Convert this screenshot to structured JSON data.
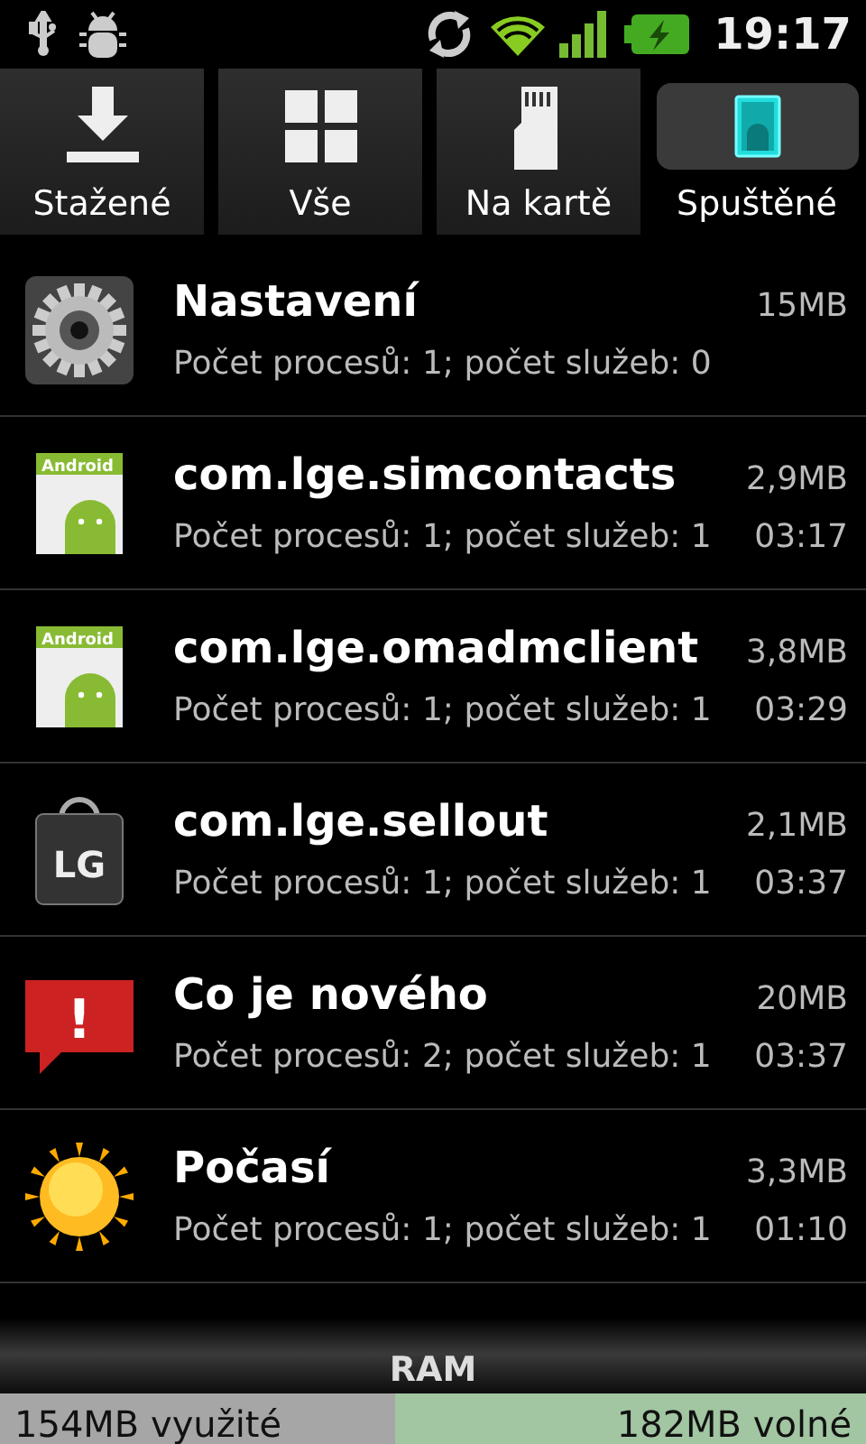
{
  "status_bar": {
    "time": "19:17"
  },
  "tabs": [
    {
      "label": "Stažené",
      "kind": "download",
      "selected": false
    },
    {
      "label": "Vše",
      "kind": "grid",
      "selected": false
    },
    {
      "label": "Na kartě",
      "kind": "sdcard",
      "selected": false
    },
    {
      "label": "Spuštěné",
      "kind": "running",
      "selected": true
    }
  ],
  "processes": [
    {
      "name": "Nastavení",
      "size": "15MB",
      "details": "Počet procesů: 1; počet služeb: 0",
      "kind": "settings"
    },
    {
      "name": "com.lge.simcontacts",
      "size": "2,9MB",
      "details": "Počet procesů: 1; počet služeb: 1",
      "time": "03:17",
      "kind": "apk",
      "icon_label": "Android"
    },
    {
      "name": "com.lge.omadmclient",
      "size": "3,8MB",
      "details": "Počet procesů: 1; počet služeb: 1",
      "time": "03:29",
      "kind": "apk",
      "icon_label": "Android"
    },
    {
      "name": "com.lge.sellout",
      "size": "2,1MB",
      "details": "Počet procesů: 1; počet služeb: 1",
      "time": "03:37",
      "kind": "lg",
      "icon_label": "LG"
    },
    {
      "name": "Co je nového",
      "size": "20MB",
      "details": "Počet procesů: 2; počet služeb: 1",
      "time": "03:37",
      "kind": "alert",
      "icon_label": "!"
    },
    {
      "name": "Počasí",
      "size": "3,3MB",
      "details": "Počet procesů: 1; počet služeb: 1",
      "time": "01:10",
      "kind": "sun"
    }
  ],
  "memory": {
    "title": "RAM",
    "used": "154MB využité",
    "free": "182MB volné",
    "level": 0.456
  }
}
